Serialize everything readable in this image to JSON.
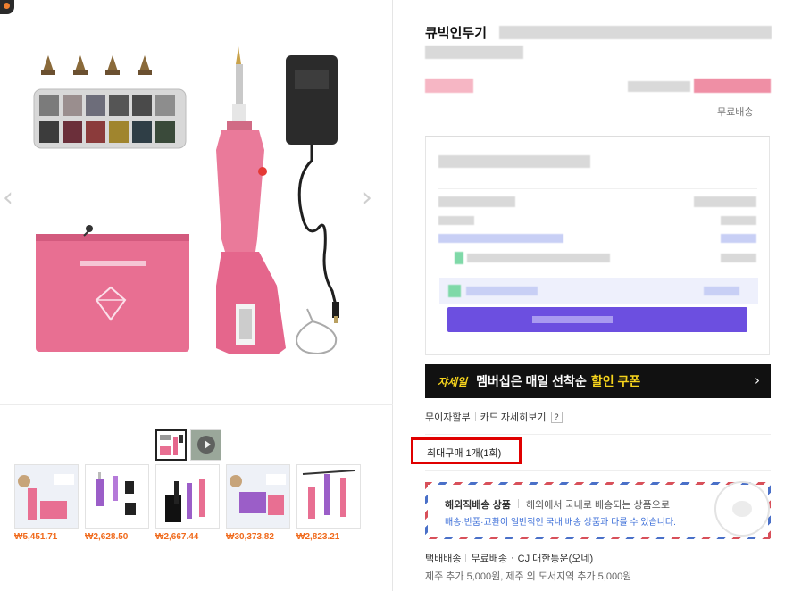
{
  "product": {
    "title_prefix": "큐빅인두기"
  },
  "gallery": {
    "prev_arrow": "‹",
    "next_arrow": "›"
  },
  "related_products": [
    {
      "price": "₩5,451.71"
    },
    {
      "price": "₩2,628.50"
    },
    {
      "price": "₩2,667.44"
    },
    {
      "price": "₩30,373.82"
    },
    {
      "price": "₩2,823.21"
    }
  ],
  "shipping": {
    "free_label": "무료배송"
  },
  "banner": {
    "logo": "쟈세일",
    "text": "멤버십은 매일 선착순",
    "highlight": "할인 쿠폰",
    "chevron": "›"
  },
  "links": {
    "installment": "무이자할부",
    "card_detail": "카드 자세히보기",
    "help": "?"
  },
  "max_purchase": "최대구매 1개(1회)",
  "overseas": {
    "title": "해외직배송 상품",
    "desc": "해외에서 국내로 배송되는 상품으로",
    "sub": "배송·반품·교환이 일반적인 국내 배송 상품과 다를 수 있습니다."
  },
  "delivery": {
    "label": "택배배송",
    "free": "무료배송",
    "carrier": "CJ 대한통운(오네)",
    "extra_fee": "제주 추가 5,000원, 제주 외 도서지역 추가 5,000원"
  },
  "colors": {
    "price_orange": "#f06a1c",
    "highlight_red": "#e00000",
    "banner_yellow": "#f5d31c",
    "coupon_purple": "#6c4fe0"
  }
}
